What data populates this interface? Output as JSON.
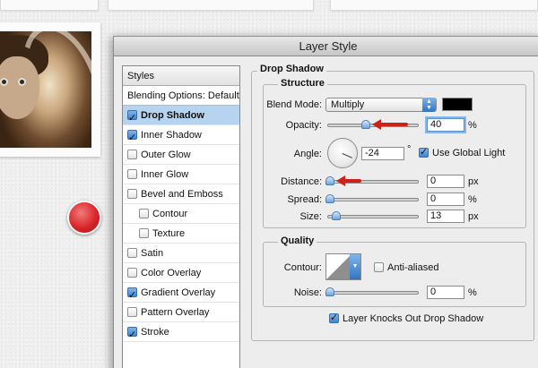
{
  "dialog": {
    "title": "Layer Style"
  },
  "styles_panel": {
    "header": "Styles",
    "blending_label": "Blending Options: Default",
    "items": [
      {
        "label": "Drop Shadow",
        "checked": true,
        "selected": true
      },
      {
        "label": "Inner Shadow",
        "checked": true
      },
      {
        "label": "Outer Glow",
        "checked": false
      },
      {
        "label": "Inner Glow",
        "checked": false
      },
      {
        "label": "Bevel and Emboss",
        "checked": false
      },
      {
        "label": "Contour",
        "checked": false,
        "indent": true
      },
      {
        "label": "Texture",
        "checked": false,
        "indent": true
      },
      {
        "label": "Satin",
        "checked": false
      },
      {
        "label": "Color Overlay",
        "checked": false
      },
      {
        "label": "Gradient Overlay",
        "checked": true
      },
      {
        "label": "Pattern Overlay",
        "checked": false
      },
      {
        "label": "Stroke",
        "checked": true
      }
    ]
  },
  "drop_shadow": {
    "title": "Drop Shadow",
    "structure": {
      "title": "Structure",
      "blend_mode_label": "Blend Mode:",
      "blend_mode_value": "Multiply",
      "shadow_color": "#000000",
      "opacity_label": "Opacity:",
      "opacity_value": "40",
      "opacity_unit": "%",
      "angle_label": "Angle:",
      "angle_value": "-24",
      "angle_unit": "°",
      "global_light_label": "Use Global Light",
      "global_light_checked": true,
      "distance_label": "Distance:",
      "distance_value": "0",
      "distance_unit": "px",
      "spread_label": "Spread:",
      "spread_value": "0",
      "spread_unit": "%",
      "size_label": "Size:",
      "size_value": "13",
      "size_unit": "px"
    },
    "quality": {
      "title": "Quality",
      "contour_label": "Contour:",
      "anti_aliased_label": "Anti-aliased",
      "anti_aliased_checked": false,
      "noise_label": "Noise:",
      "noise_value": "0",
      "noise_unit": "%"
    },
    "knocks_out_label": "Layer Knocks Out Drop Shadow",
    "knocks_out_checked": true
  },
  "colors": {
    "selection": "#b6d4ef",
    "arrow": "#cc2218",
    "red_dot": "#d9262a"
  }
}
